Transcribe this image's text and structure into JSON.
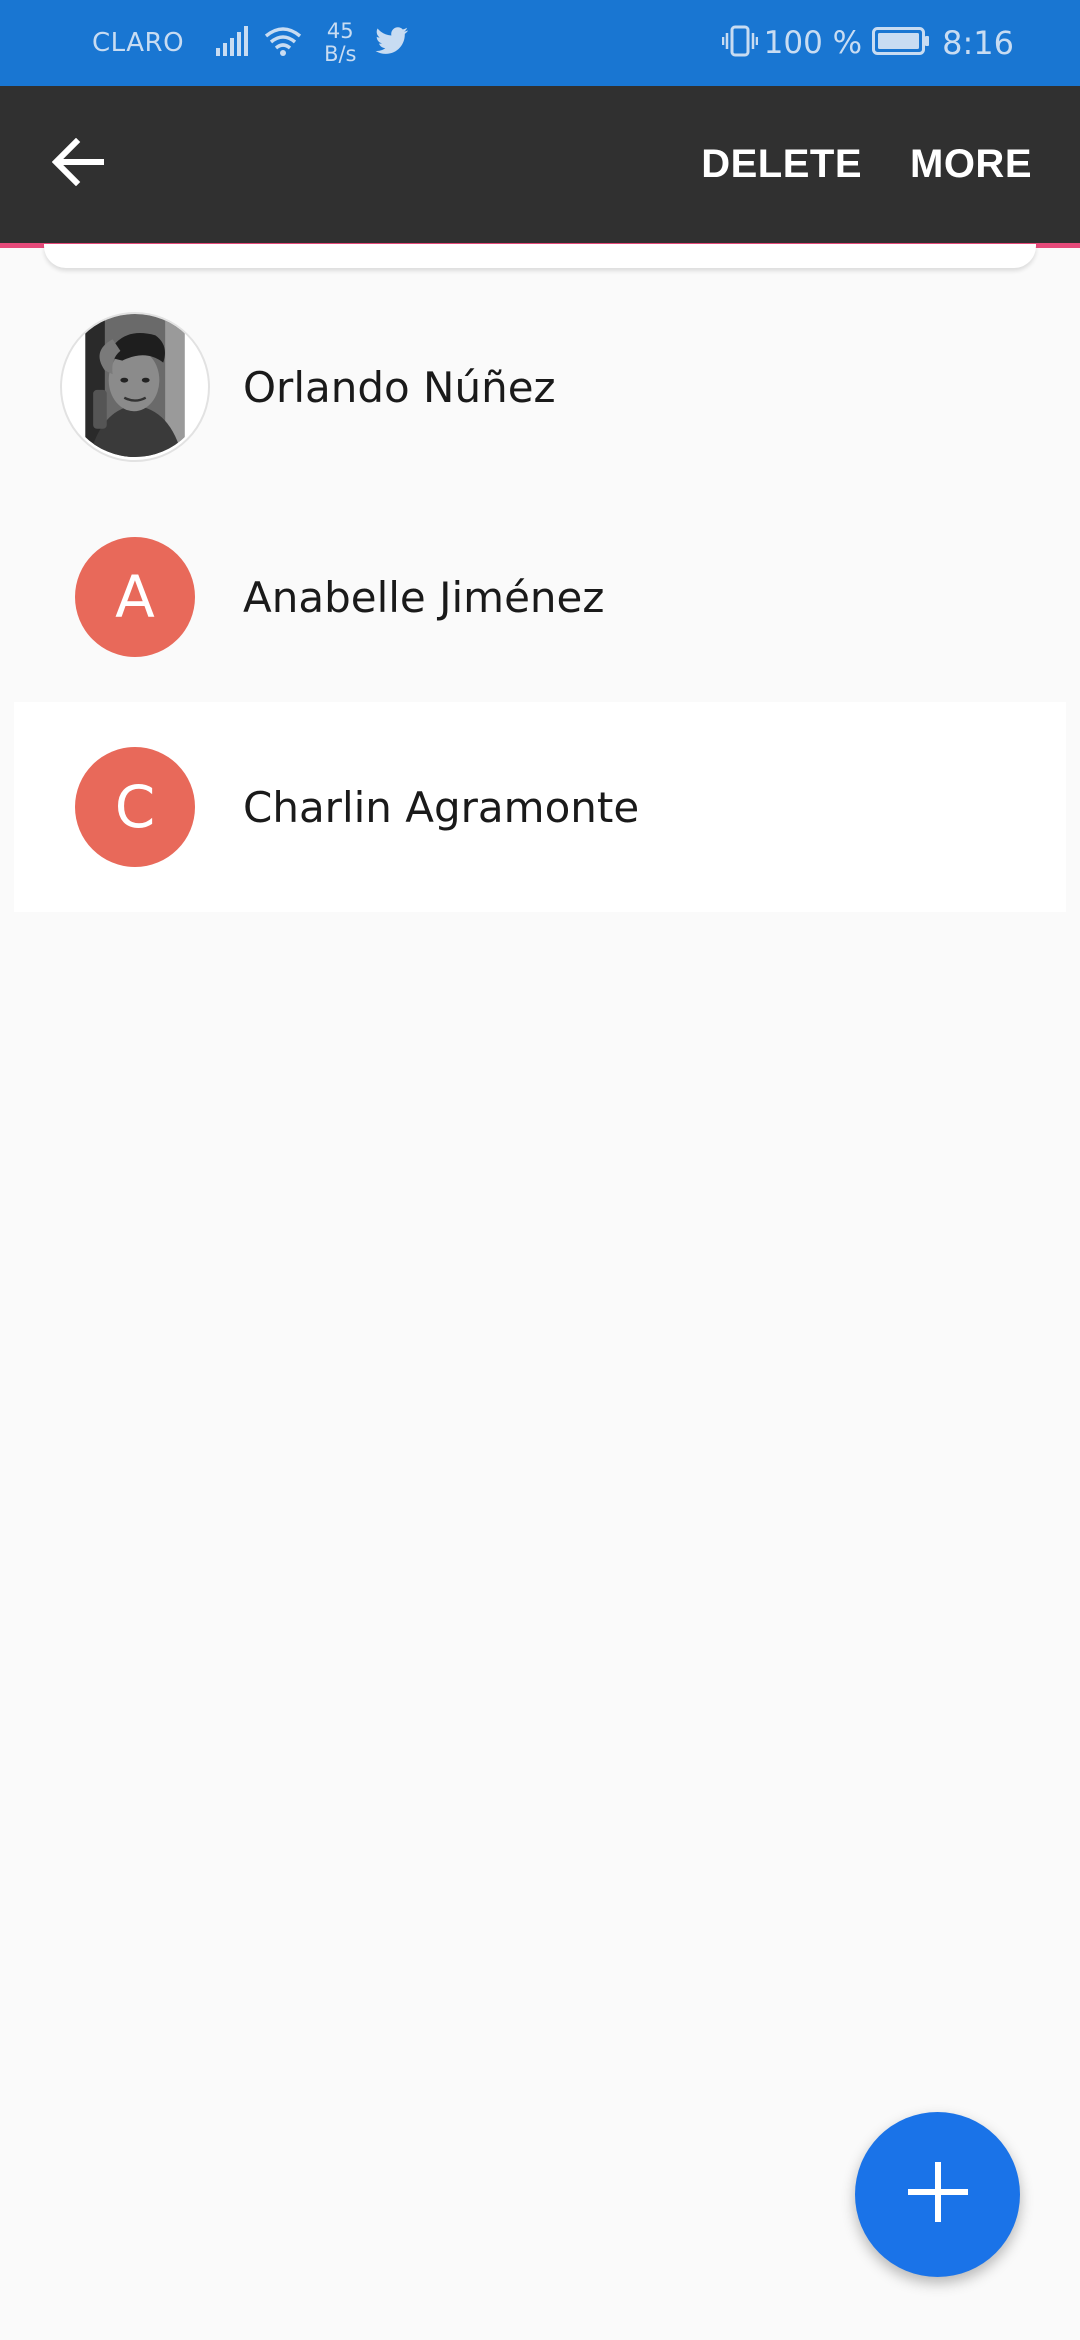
{
  "status_bar": {
    "carrier": "CLARO",
    "net_speed_value": "45",
    "net_speed_unit": "B/s",
    "battery": "100 %",
    "time": "8:16"
  },
  "toolbar": {
    "delete_label": "DELETE",
    "more_label": "MORE"
  },
  "contacts": [
    {
      "name": "Orlando Núñez",
      "avatar_type": "photo",
      "initial": ""
    },
    {
      "name": "Anabelle Jiménez",
      "avatar_type": "initial",
      "initial": "A",
      "avatar_color": "#e8695a"
    },
    {
      "name": "Charlin Agramonte",
      "avatar_type": "initial",
      "initial": "C",
      "avatar_color": "#e8695a",
      "selected": true
    }
  ],
  "colors": {
    "status_bar": "#1976d2",
    "toolbar": "#303030",
    "toolbar_accent": "#e64a7a",
    "avatar": "#e8695a",
    "fab": "#1a73e8"
  },
  "icons": {
    "back": "arrow-back-icon",
    "fab": "plus-icon"
  }
}
